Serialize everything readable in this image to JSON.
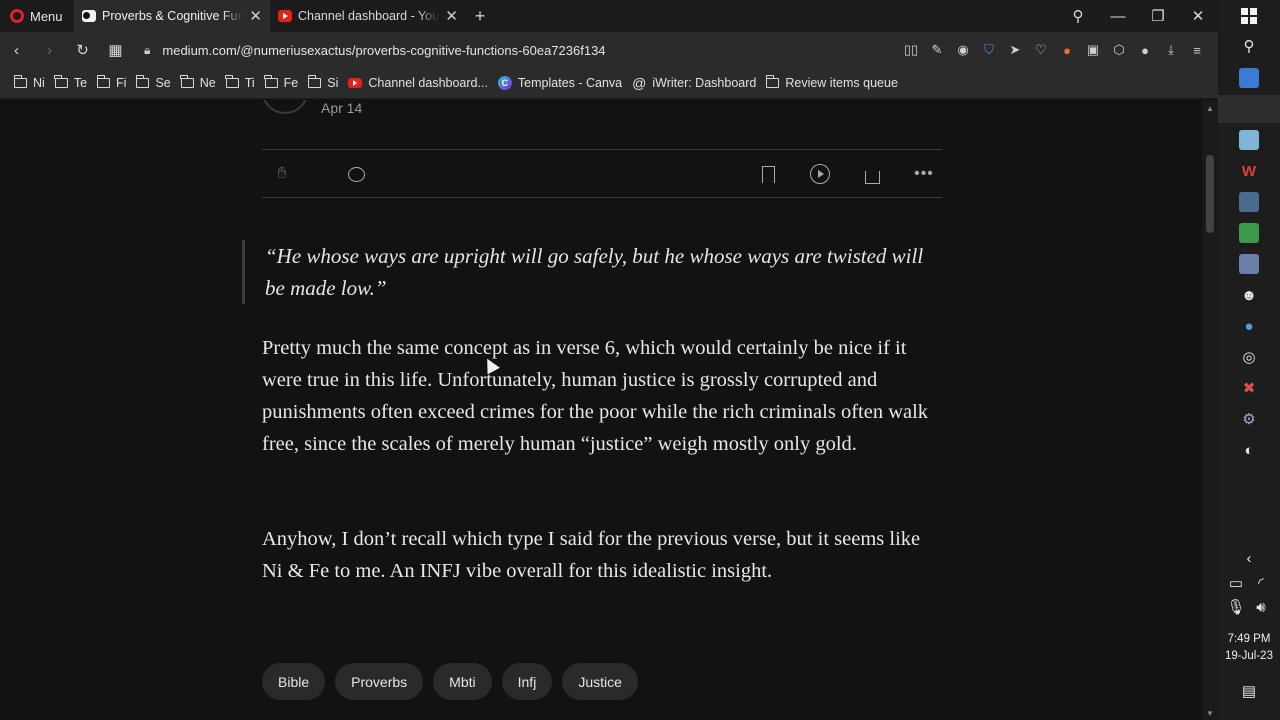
{
  "browser": {
    "menu_label": "Menu",
    "tabs": [
      {
        "title": "Proverbs & Cognitive Functions",
        "active": true,
        "icon": "medium-icon"
      },
      {
        "title": "Channel dashboard - YouTube Studio",
        "active": false,
        "icon": "youtube-icon"
      }
    ],
    "url": "medium.com/@numeriusexactus/proverbs-cognitive-functions-60ea7236f134",
    "bookmarks": [
      {
        "label": "Ni",
        "icon": "folder-icon"
      },
      {
        "label": "Te",
        "icon": "folder-icon"
      },
      {
        "label": "Fi",
        "icon": "folder-icon"
      },
      {
        "label": "Se",
        "icon": "folder-icon"
      },
      {
        "label": "Ne",
        "icon": "folder-icon"
      },
      {
        "label": "Ti",
        "icon": "folder-icon"
      },
      {
        "label": "Fe",
        "icon": "folder-icon"
      },
      {
        "label": "Si",
        "icon": "folder-icon"
      },
      {
        "label": "Channel dashboard...",
        "icon": "youtube-icon"
      },
      {
        "label": "Templates - Canva",
        "icon": "canva-icon"
      },
      {
        "label": "iWriter: Dashboard",
        "icon": "at-icon"
      },
      {
        "label": "Review items queue",
        "icon": "folder-icon"
      }
    ]
  },
  "article": {
    "date": "Apr 14",
    "quote": "“He whose ways are upright will go safely, but he whose ways are twisted will be made low.”",
    "paragraph1": "Pretty much the same concept as in verse 6, which would certainly be nice if it were true in this life. Unfortunately, human justice is grossly corrupted and punishments often exceed crimes for the poor while the rich criminals often walk free, since the scales of merely human “justice” weigh mostly only gold.",
    "paragraph2": "Anyhow, I don’t recall which type I said for the previous verse, but it seems like Ni & Fe to me. An INFJ vibe overall for this idealistic insight.",
    "tags": [
      "Bible",
      "Proverbs",
      "Mbti",
      "Infj",
      "Justice"
    ]
  },
  "taskbar": {
    "time": "7:49 PM",
    "date": "19-Jul-23"
  },
  "colors": {
    "opera_red": "#e0202c",
    "youtube_red": "#e62117",
    "page_bg": "#121212"
  }
}
